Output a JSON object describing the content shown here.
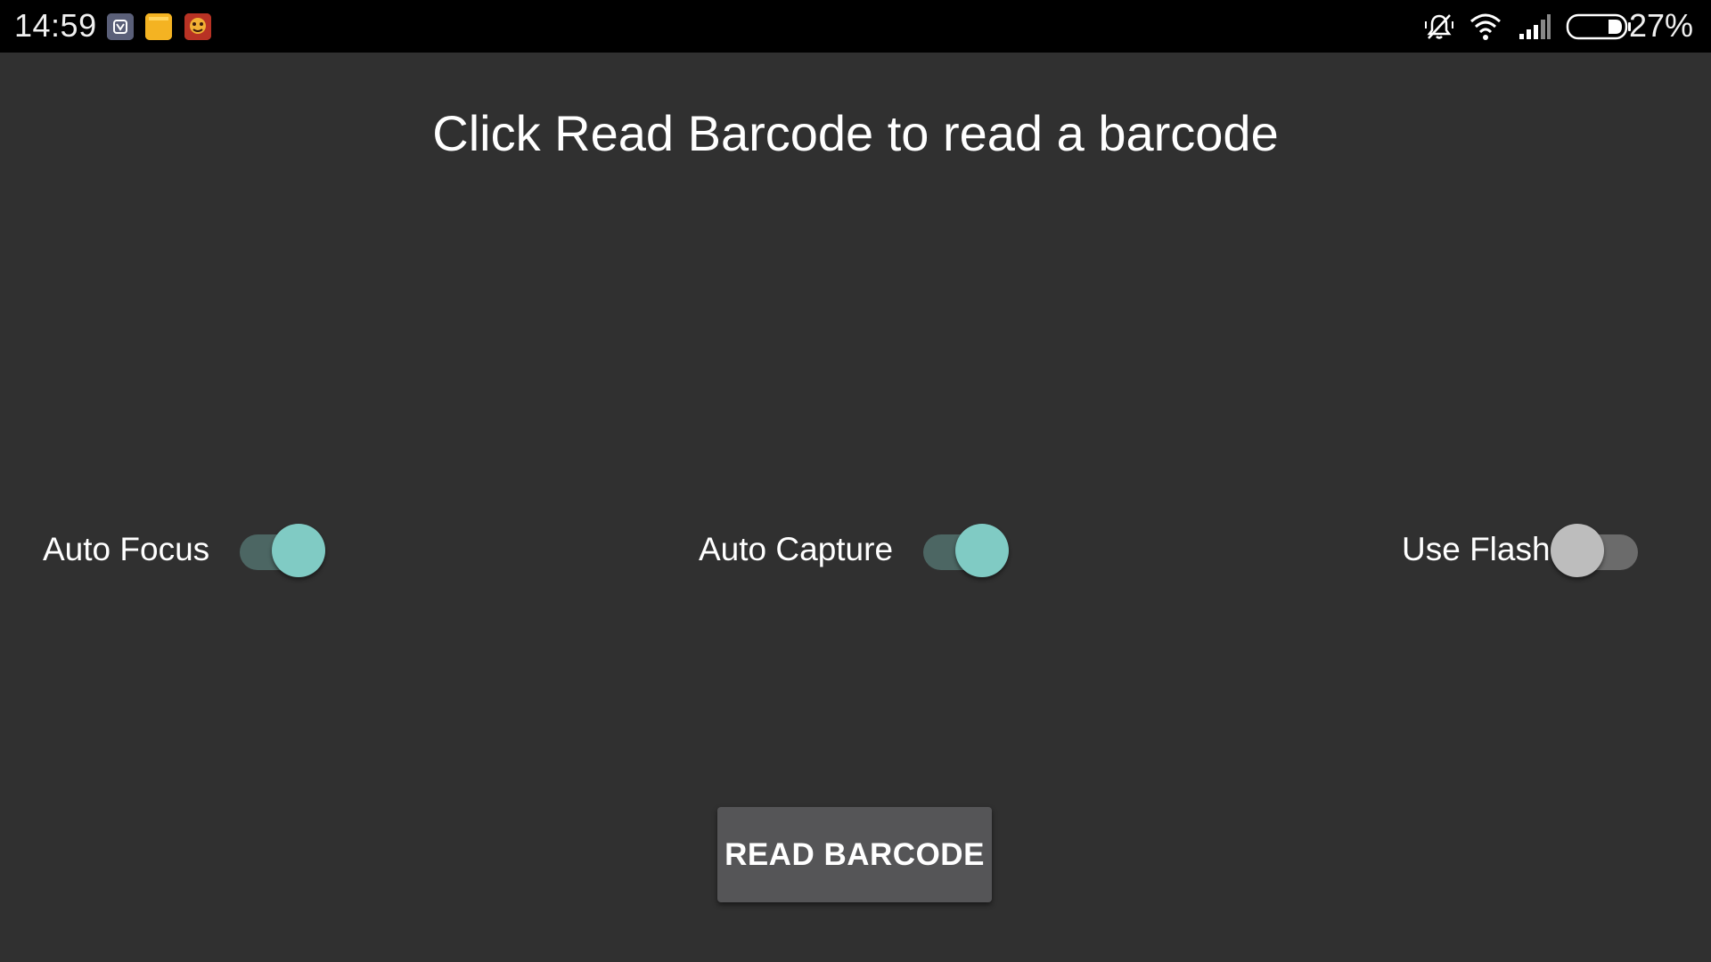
{
  "status_bar": {
    "time": "14:59",
    "battery_percent": "27%",
    "notification_icons": [
      "app-notification-icon",
      "notes-icon",
      "game-icon"
    ],
    "system_icons": [
      "vibrate-off-icon",
      "wifi-icon",
      "signal-icon",
      "battery-icon"
    ]
  },
  "main": {
    "title": "Click Read Barcode to read a barcode",
    "switches": [
      {
        "label": "Auto Focus",
        "checked": true
      },
      {
        "label": "Auto Capture",
        "checked": true
      },
      {
        "label": "Use Flash",
        "checked": false
      }
    ],
    "read_button_label": "READ BARCODE"
  },
  "colors": {
    "background": "#303030",
    "status_bar": "#000000",
    "switch_on_thumb": "#80cbc4",
    "switch_on_track": "#4c6663",
    "switch_off_thumb": "#bdbdbd",
    "switch_off_track": "#6b6b6b",
    "button": "#555557"
  }
}
